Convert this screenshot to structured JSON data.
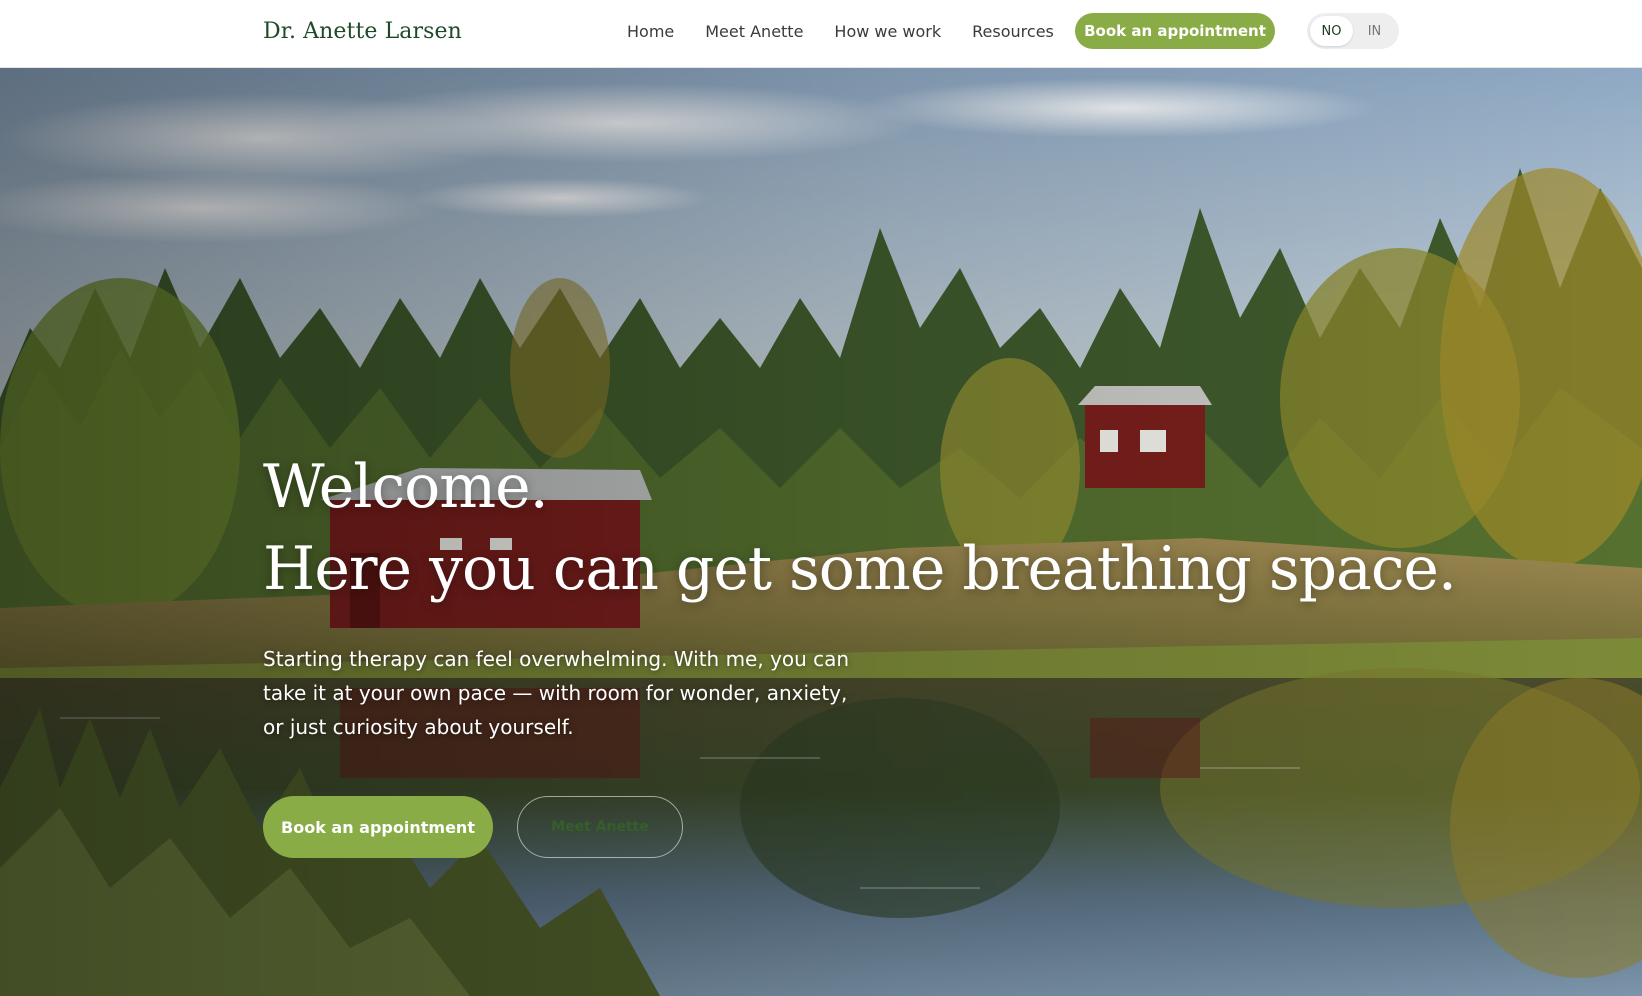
{
  "brand": {
    "name": "Dr. Anette Larsen"
  },
  "nav": {
    "items": [
      {
        "label": "Home"
      },
      {
        "label": "Meet Anette"
      },
      {
        "label": "How we work"
      },
      {
        "label": "Resources"
      }
    ],
    "cta_label": "Book an appointment"
  },
  "language": {
    "options": [
      "NO",
      "IN"
    ],
    "selected": "NO"
  },
  "hero": {
    "title_line1": "Welcome.",
    "title_line2": "Here you can get some breathing space.",
    "subtitle": "Starting therapy can feel overwhelming. With me, you can take it at your own pace — with room for wonder, anxiety, or just curiosity about yourself.",
    "primary_button": "Book an appointment",
    "secondary_button": "Meet Anette"
  },
  "colors": {
    "brand_green": "#8aac47",
    "logo_green": "#1f4a26",
    "nav_text": "#3b3b3b"
  },
  "icons": {
    "language_toggle": "language-toggle"
  }
}
